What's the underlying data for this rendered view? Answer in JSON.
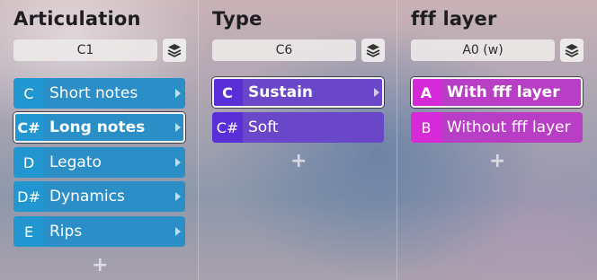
{
  "columns": [
    {
      "title": "Articulation",
      "field_value": "C1",
      "items": [
        {
          "key": "C",
          "label": "Short notes",
          "selected": false
        },
        {
          "key": "C#",
          "label": "Long notes",
          "selected": true
        },
        {
          "key": "D",
          "label": "Legato",
          "selected": false
        },
        {
          "key": "D#",
          "label": "Dynamics",
          "selected": false
        },
        {
          "key": "E",
          "label": "Rips",
          "selected": false
        }
      ],
      "add_label": "+"
    },
    {
      "title": "Type",
      "field_value": "C6",
      "items": [
        {
          "key": "C",
          "label": "Sustain",
          "selected": true
        },
        {
          "key": "C#",
          "label": "Soft",
          "selected": false
        }
      ],
      "add_label": "+"
    },
    {
      "title": "fff layer",
      "field_value": "A0 (w)",
      "items": [
        {
          "key": "A",
          "label": "With fff layer",
          "selected": true
        },
        {
          "key": "B",
          "label": "Without fff layer",
          "selected": false
        }
      ],
      "add_label": "+"
    }
  ],
  "icons": {
    "layer_button": "layers-icon",
    "item_arrow": "chevron-right-icon",
    "add": "plus-icon"
  },
  "colors": {
    "articulation": "#2b8ec7",
    "type": "#6a46c9",
    "fff_layer": "#b93ec6"
  }
}
